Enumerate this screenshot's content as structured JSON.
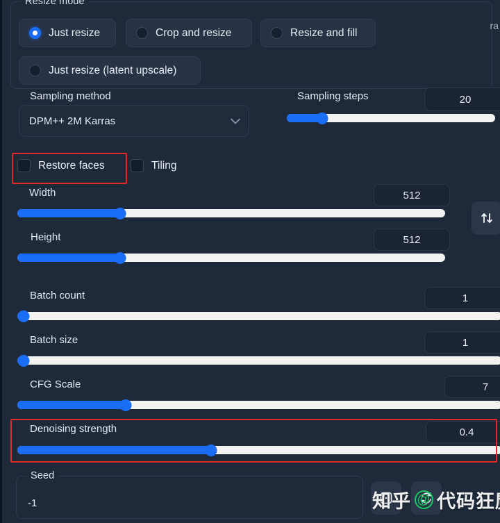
{
  "resize_mode": {
    "legend": "Resize mode",
    "options": [
      {
        "label": "Just resize",
        "selected": true
      },
      {
        "label": "Crop and resize",
        "selected": false
      },
      {
        "label": "Resize and fill",
        "selected": false
      },
      {
        "label": "Just resize (latent upscale)",
        "selected": false
      }
    ]
  },
  "sampling": {
    "method_label": "Sampling method",
    "method_value": "DPM++ 2M Karras",
    "steps_label": "Sampling steps",
    "steps_value": "20"
  },
  "toggles": [
    {
      "label": "Restore faces",
      "checked": false,
      "highlighted": true
    },
    {
      "label": "Tiling",
      "checked": false,
      "highlighted": false
    }
  ],
  "dimensions": {
    "width": {
      "label": "Width",
      "value": "512"
    },
    "height": {
      "label": "Height",
      "value": "512"
    },
    "swap_icon": "swap-vertical-icon"
  },
  "batch": {
    "count": {
      "label": "Batch count",
      "value": "1"
    },
    "size": {
      "label": "Batch size",
      "value": "1"
    }
  },
  "cfg": {
    "label": "CFG Scale",
    "value": "7"
  },
  "denoising": {
    "label": "Denoising strength",
    "value": "0.4",
    "highlighted": true
  },
  "seed": {
    "legend": "Seed",
    "value": "-1",
    "buttons": [
      {
        "icon": "dice-icon"
      },
      {
        "icon": "recycle-icon"
      }
    ]
  },
  "watermark": {
    "site": "知乎",
    "at": "@",
    "user": "代码狂魔",
    "tail": "ra"
  },
  "colors": {
    "accent": "#1a6ef5",
    "panel": "#1e2939",
    "track": "#f2f2f0",
    "annotation": "#e02b2b",
    "green": "#17c964"
  }
}
